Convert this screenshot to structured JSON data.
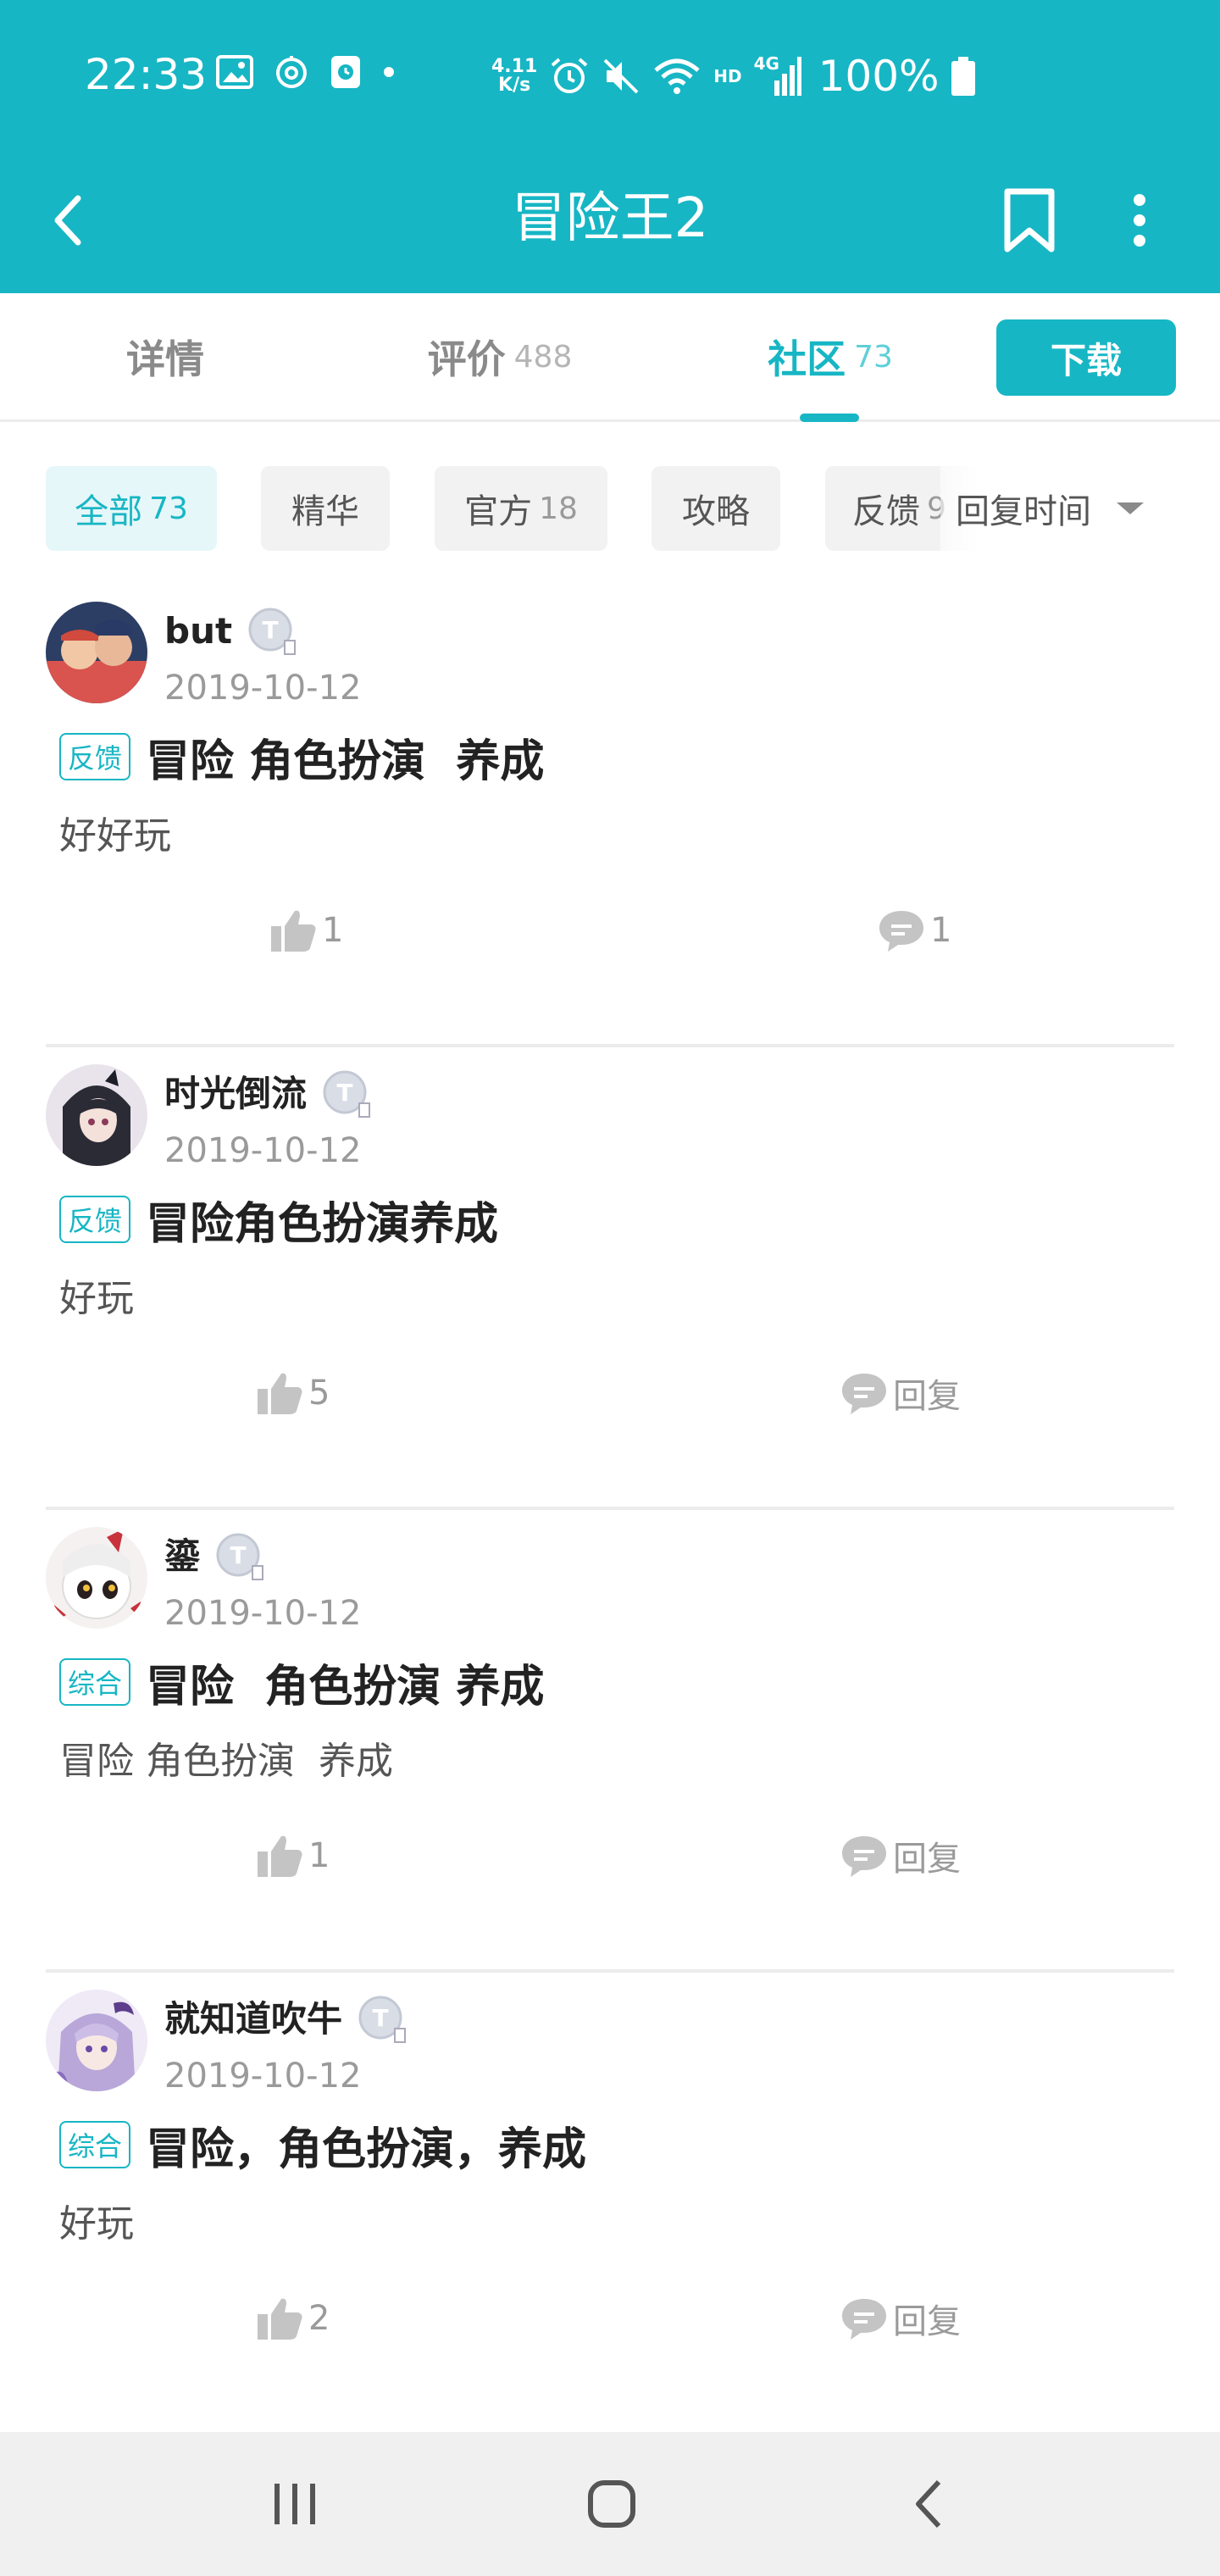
{
  "status_bar": {
    "time": "22:33",
    "net_speed_value": "4.11",
    "net_speed_unit": "K/s",
    "network": "4G",
    "hd": "HD",
    "battery": "100%"
  },
  "nav": {
    "title": "冒险王2"
  },
  "tabs": [
    {
      "label": "详情",
      "count": ""
    },
    {
      "label": "评价",
      "count": "488"
    },
    {
      "label": "社区",
      "count": "73"
    }
  ],
  "download_label": "下载",
  "filters": [
    {
      "label": "全部",
      "count": "73"
    },
    {
      "label": "精华",
      "count": ""
    },
    {
      "label": "官方",
      "count": "18"
    },
    {
      "label": "攻略",
      "count": ""
    },
    {
      "label": "反馈",
      "count": "9"
    }
  ],
  "sort_label": "回复时间",
  "colors": {
    "accent": "#17B6C4",
    "accent_light_bg": "#E6F7F9",
    "text_primary": "#222222",
    "text_secondary": "#9A9A9A",
    "nav_bar_bg": "#F0F0F0"
  },
  "posts": [
    {
      "username": "but",
      "date": "2019-10-12",
      "tag": "反馈",
      "title": "冒险 角色扮演  养成",
      "body": "好好玩",
      "likes": "1",
      "replies": "1"
    },
    {
      "username": "时光倒流",
      "date": "2019-10-12",
      "tag": "反馈",
      "title": "冒险角色扮演养成",
      "body": "好玩",
      "likes": "5",
      "replies": "回复"
    },
    {
      "username": "鎏",
      "date": "2019-10-12",
      "tag": "综合",
      "title": "冒险  角色扮演 养成",
      "body": "冒险 角色扮演  养成",
      "likes": "1",
      "replies": "回复"
    },
    {
      "username": "就知道吹牛",
      "date": "2019-10-12",
      "tag": "综合",
      "title": "冒险，角色扮演，养成",
      "body": "好玩",
      "likes": "2",
      "replies": "回复"
    }
  ]
}
